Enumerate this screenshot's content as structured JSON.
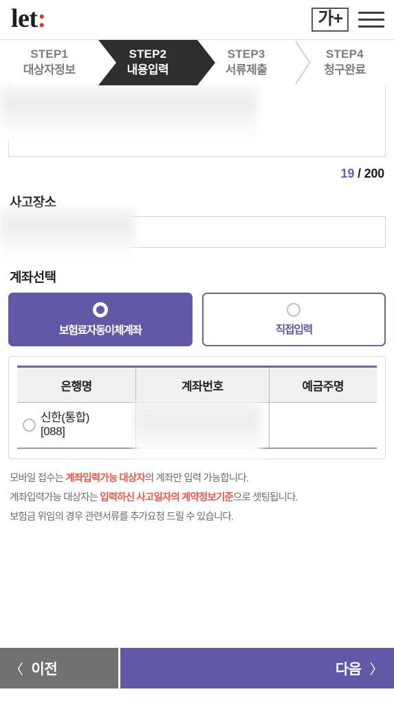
{
  "header": {
    "logo_text": "let",
    "logo_colon": ":",
    "fontsize_button": "가+",
    "menu_icon": "hamburger-menu-icon"
  },
  "steps": [
    {
      "en": "STEP1",
      "ko": "대상자정보",
      "active": false
    },
    {
      "en": "STEP2",
      "ko": "내용입력",
      "active": true
    },
    {
      "en": "STEP3",
      "ko": "서류제출",
      "active": false
    },
    {
      "en": "STEP4",
      "ko": "청구완료",
      "active": false
    }
  ],
  "description": {
    "textarea_value": "",
    "counter_current": "19",
    "counter_separator": " / ",
    "counter_max": "200"
  },
  "accident_place": {
    "label": "사고장소",
    "input_value": "",
    "placeholder": ""
  },
  "account_select": {
    "label": "계좌선택",
    "options": [
      {
        "label": "보험료자동이체계좌",
        "selected": true
      },
      {
        "label": "직접입력",
        "selected": false
      }
    ]
  },
  "account_table": {
    "headers": [
      "은행명",
      "계좌번호",
      "예금주명"
    ],
    "rows": [
      {
        "bank_name_line1": "신한(통합)",
        "bank_name_line2": "[088]",
        "account_number": "",
        "holder_name": "",
        "selected": false
      }
    ]
  },
  "notices": [
    {
      "parts": [
        {
          "text": "모바일 접수는 ",
          "highlight": false
        },
        {
          "text": "계좌입력가능 대상자",
          "highlight": true
        },
        {
          "text": "의 계좌만 입력 가능합니다.",
          "highlight": false
        }
      ]
    },
    {
      "parts": [
        {
          "text": "계좌입력가능 대상자는 ",
          "highlight": false
        },
        {
          "text": "입력하신 사고일자의 계약정보기준",
          "highlight": true
        },
        {
          "text": "으로 셋팅됩니다.",
          "highlight": false
        }
      ]
    },
    {
      "parts": [
        {
          "text": "보험금 위임의 경우 관련서류를 추가요청 드릴 수 있습니다.",
          "highlight": false
        }
      ]
    }
  ],
  "bottom_nav": {
    "prev_label": "이전",
    "prev_chevron": "〈",
    "next_label": "다음",
    "next_chevron": "〉"
  },
  "colors": {
    "brand_purple": "#6258a8",
    "border_purple": "#6b5fae",
    "logo_red": "#e2342a",
    "notice_red": "#f0564b",
    "step_active_bg": "#2e2e2e",
    "prev_gray": "#717171"
  }
}
